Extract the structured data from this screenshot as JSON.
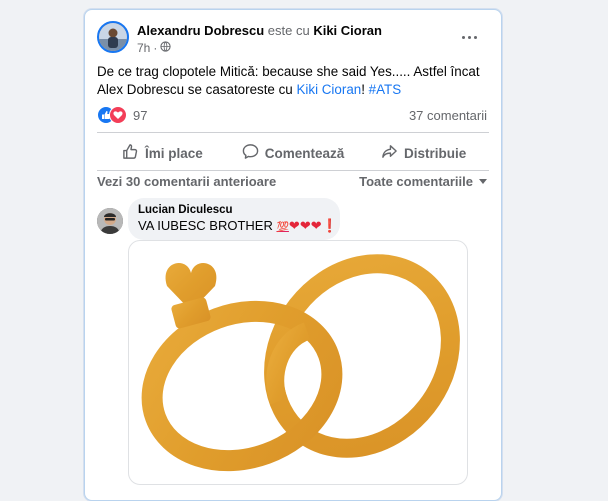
{
  "post": {
    "author": "Alexandru Dobrescu",
    "with_text": "este cu",
    "tagged": "Kiki Cioran",
    "time": "7h",
    "privacy_icon": "globe-icon",
    "text_part1": "De ce trag clopotele Mitică: because she said   Yes..... Astfel încat Alex Dobrescu se casatoreste cu ",
    "text_link": "Kiki Cioran",
    "text_part2": "! ",
    "hashtag": "#ATS"
  },
  "reactions": {
    "icons": [
      "like-icon",
      "love-icon"
    ],
    "count": "97",
    "comments": "37 comentarii"
  },
  "actions": {
    "like": "Îmi place",
    "comment": "Comentează",
    "share": "Distribuie"
  },
  "comments_bar": {
    "view_previous": "Vezi 30 comentarii anterioare",
    "sort": "Toate comentariile"
  },
  "comment": {
    "name": "Lucian Diculescu",
    "text": "VA IUBESC BROTHER ",
    "emoji_hundred": "💯",
    "hearts": "❤❤❤",
    "exclamation": "❗"
  },
  "colors": {
    "link": "#1877f2",
    "muted": "#65676b",
    "gold": "#e3a432",
    "card_border": "#b9d3ee"
  }
}
